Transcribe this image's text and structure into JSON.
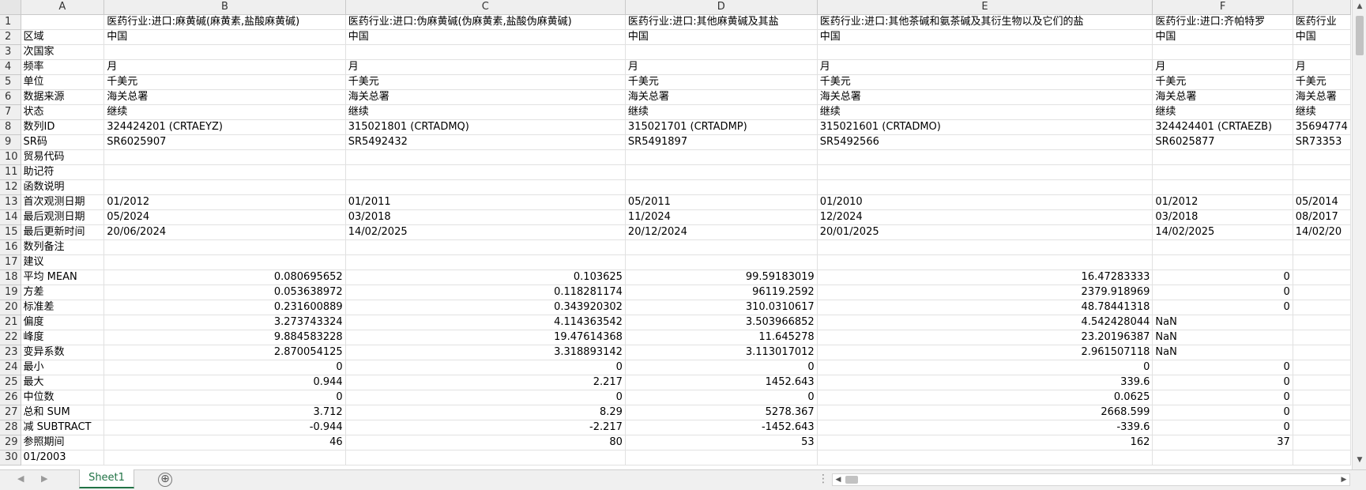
{
  "columns": [
    "A",
    "B",
    "C",
    "D",
    "E",
    "F"
  ],
  "row_numbers": [
    "1",
    "2",
    "3",
    "4",
    "5",
    "6",
    "7",
    "8",
    "9",
    "10",
    "11",
    "12",
    "13",
    "14",
    "15",
    "16",
    "17",
    "18",
    "19",
    "20",
    "21",
    "22",
    "23",
    "24",
    "25",
    "26",
    "27",
    "28",
    "29",
    "30"
  ],
  "rows": [
    [
      "",
      "医药行业:进口:麻黄碱(麻黄素,盐酸麻黄碱)",
      "医药行业:进口:伪麻黄碱(伪麻黄素,盐酸伪麻黄碱)",
      "医药行业:进口:其他麻黄碱及其盐",
      "医药行业:进口:其他茶碱和氨茶碱及其衍生物以及它们的盐",
      "医药行业:进口:齐帕特罗",
      "医药行业"
    ],
    [
      "区域",
      "中国",
      "中国",
      "中国",
      "中国",
      "中国",
      "中国"
    ],
    [
      "次国家",
      "",
      "",
      "",
      "",
      "",
      ""
    ],
    [
      "频率",
      "月",
      "月",
      "月",
      "月",
      "月",
      "月"
    ],
    [
      "单位",
      "千美元",
      "千美元",
      "千美元",
      "千美元",
      "千美元",
      "千美元"
    ],
    [
      "数据来源",
      "海关总署",
      "海关总署",
      "海关总署",
      "海关总署",
      "海关总署",
      "海关总署"
    ],
    [
      "状态",
      "继续",
      "继续",
      "继续",
      "继续",
      "继续",
      "继续"
    ],
    [
      "数列ID",
      "324424201 (CRTAEYZ)",
      "315021801 (CRTADMQ)",
      "315021701 (CRTADMP)",
      "315021601 (CRTADMO)",
      "324424401 (CRTAEZB)",
      "35694774"
    ],
    [
      "SR码",
      "SR6025907",
      "SR5492432",
      "SR5491897",
      "SR5492566",
      "SR6025877",
      "SR73353"
    ],
    [
      "贸易代码",
      "",
      "",
      "",
      "",
      "",
      ""
    ],
    [
      "助记符",
      "",
      "",
      "",
      "",
      "",
      ""
    ],
    [
      "函数说明",
      "",
      "",
      "",
      "",
      "",
      ""
    ],
    [
      "首次观测日期",
      "01/2012",
      "01/2011",
      "05/2011",
      "01/2010",
      "01/2012",
      "05/2014"
    ],
    [
      "最后观测日期",
      "05/2024",
      "03/2018",
      "11/2024",
      "12/2024",
      "03/2018",
      "08/2017"
    ],
    [
      "最后更新时间",
      "20/06/2024",
      "14/02/2025",
      "20/12/2024",
      "20/01/2025",
      "14/02/2025",
      "14/02/20"
    ],
    [
      "数列备注",
      "",
      "",
      "",
      "",
      "",
      ""
    ],
    [
      "建议",
      "",
      "",
      "",
      "",
      "",
      ""
    ],
    [
      "平均 MEAN",
      "0.080695652",
      "0.103625",
      "99.59183019",
      "16.47283333",
      "0",
      ""
    ],
    [
      "方差",
      "0.053638972",
      "0.118281174",
      "96119.2592",
      "2379.918969",
      "0",
      ""
    ],
    [
      "标准差",
      "0.231600889",
      "0.343920302",
      "310.0310617",
      "48.78441318",
      "0",
      ""
    ],
    [
      "偏度",
      "3.273743324",
      "4.114363542",
      "3.503966852",
      "4.542428044",
      "NaN",
      ""
    ],
    [
      "峰度",
      "9.884583228",
      "19.47614368",
      "11.645278",
      "23.20196387",
      "NaN",
      ""
    ],
    [
      "变异系数",
      "2.870054125",
      "3.318893142",
      "3.113017012",
      "2.961507118",
      "NaN",
      ""
    ],
    [
      "最小",
      "0",
      "0",
      "0",
      "0",
      "0",
      ""
    ],
    [
      "最大",
      "0.944",
      "2.217",
      "1452.643",
      "339.6",
      "0",
      ""
    ],
    [
      "中位数",
      "0",
      "0",
      "0",
      "0.0625",
      "0",
      ""
    ],
    [
      "总和 SUM",
      "3.712",
      "8.29",
      "5278.367",
      "2668.599",
      "0",
      ""
    ],
    [
      "减 SUBTRACT",
      "-0.944",
      "-2.217",
      "-1452.643",
      "-339.6",
      "0",
      ""
    ],
    [
      "参照期间",
      "46",
      "80",
      "53",
      "162",
      "37",
      ""
    ],
    [
      "01/2003",
      "",
      "",
      "",
      "",
      "",
      ""
    ]
  ],
  "sheet_tab": "Sheet1",
  "icons": {
    "add_sheet": "⊕",
    "nav_prev": "◀",
    "nav_next": "▶",
    "scroll_up": "▲",
    "scroll_down": "▼",
    "scroll_left": "◀",
    "scroll_right": "▶",
    "dots": "⋮"
  },
  "colors": {
    "accent": "#217346",
    "header_bg": "#efefef",
    "grid": "#e1e1e1"
  }
}
